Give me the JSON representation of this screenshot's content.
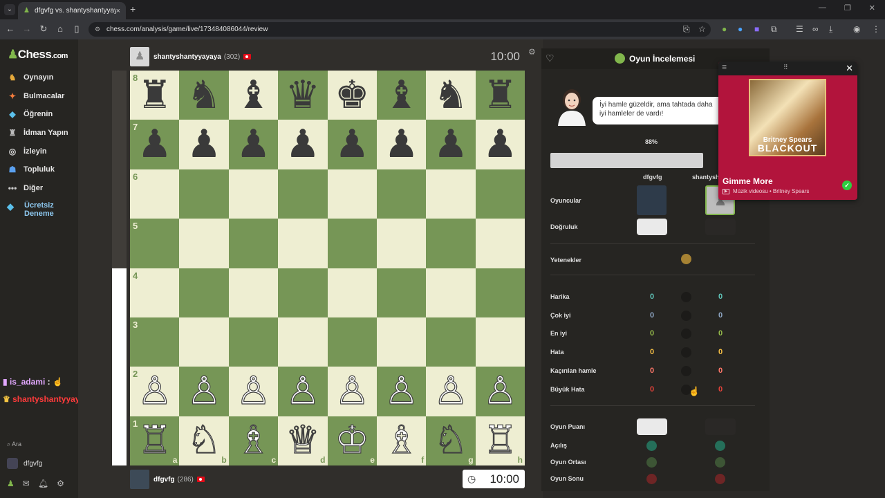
{
  "browser": {
    "tab_title": "dfgvfg vs. shantyshantyyayaya",
    "tab_close": "×",
    "new_tab": "+",
    "url": "chess.com/analysis/game/live/173484086044/review",
    "window_controls": [
      "—",
      "❐",
      "✕"
    ]
  },
  "sidebar": {
    "logo_main": "Chess",
    "logo_suffix": ".com",
    "items": [
      {
        "label": "Oynayın",
        "icon": "play-icon"
      },
      {
        "label": "Bulmacalar",
        "icon": "puzzle-icon"
      },
      {
        "label": "Öğrenin",
        "icon": "learn-icon"
      },
      {
        "label": "İdman Yapın",
        "icon": "train-icon"
      },
      {
        "label": "İzleyin",
        "icon": "watch-icon"
      },
      {
        "label": "Topluluk",
        "icon": "community-icon"
      },
      {
        "label": "Diğer",
        "icon": "more-icon"
      }
    ],
    "trial_line1": "Ücretsiz",
    "trial_line2": "Deneme",
    "search_label": "Ara",
    "username": "dfgvfg"
  },
  "chat": {
    "msg1_user": "is_adami",
    "msg1_sep": " :",
    "msg2_user": "shantyshantyyayaya",
    "msg2_sep": " :"
  },
  "game": {
    "top_player": {
      "name": "shantyshantyyayaya",
      "rating": "(302)"
    },
    "top_clock": "10:00",
    "bottom_player": {
      "name": "dfgvfg",
      "rating": "(286)"
    },
    "bottom_clock": "10:00",
    "eval_white_fraction": 0.5,
    "files": [
      "a",
      "b",
      "c",
      "d",
      "e",
      "f",
      "g",
      "h"
    ],
    "ranks": [
      "8",
      "7",
      "6",
      "5",
      "4",
      "3",
      "2",
      "1"
    ],
    "position": [
      [
        "♜",
        "♞",
        "♝",
        "♛",
        "♚",
        "♝",
        "♞",
        "♜"
      ],
      [
        "♟",
        "♟",
        "♟",
        "♟",
        "♟",
        "♟",
        "♟",
        "♟"
      ],
      [
        "",
        "",
        "",
        "",
        "",
        "",
        "",
        ""
      ],
      [
        "",
        "",
        "",
        "",
        "",
        "",
        "",
        ""
      ],
      [
        "",
        "",
        "",
        "",
        "",
        "",
        "",
        ""
      ],
      [
        "",
        "",
        "",
        "",
        "",
        "",
        "",
        ""
      ],
      [
        "♙",
        "♙",
        "♙",
        "♙",
        "♙",
        "♙",
        "♙",
        "♙"
      ],
      [
        "♖",
        "♘",
        "♗",
        "♕",
        "♔",
        "♗",
        "♘",
        "♖"
      ]
    ]
  },
  "review": {
    "title": "Oyun İncelemesi",
    "coach_message": "İyi hamle güzeldir, ama tahtada daha iyi hamleler de vardı!",
    "accuracy_percent": "88%",
    "player1_col": "dfgvfg",
    "player2_col": "shantysh",
    "row_players": "Oyuncular",
    "row_accuracy": "Doğruluk",
    "row_skills": "Yetenekler",
    "classifications": [
      {
        "label": "Harika",
        "p1": "0",
        "p2": "0",
        "color": "#5ec2b7"
      },
      {
        "label": "Çok iyi",
        "p1": "0",
        "p2": "0",
        "color": "#8ea6c4"
      },
      {
        "label": "En iyi",
        "p1": "0",
        "p2": "0",
        "color": "#96bc4b"
      },
      {
        "label": "Hata",
        "p1": "0",
        "p2": "0",
        "color": "#f7c045"
      },
      {
        "label": "Kaçırılan hamle",
        "p1": "0",
        "p2": "0",
        "color": "#ff7769"
      },
      {
        "label": "Büyük Hata",
        "p1": "0",
        "p2": "0",
        "color": "#e6423a"
      }
    ],
    "row_rating": "Oyun Puanı",
    "phases": [
      {
        "label": "Açılış",
        "color": "#256f5a"
      },
      {
        "label": "Oyun Ortası",
        "color": "#3d5535"
      },
      {
        "label": "Oyun Sonu",
        "color": "#6e2525"
      }
    ]
  },
  "media": {
    "song": "Gimme More",
    "meta": "Müzik videosu • Britney Spears",
    "album_artist": "Britney Spears",
    "album_title": "BLACKOUT",
    "drag_handle": "⠿",
    "close": "✕"
  }
}
